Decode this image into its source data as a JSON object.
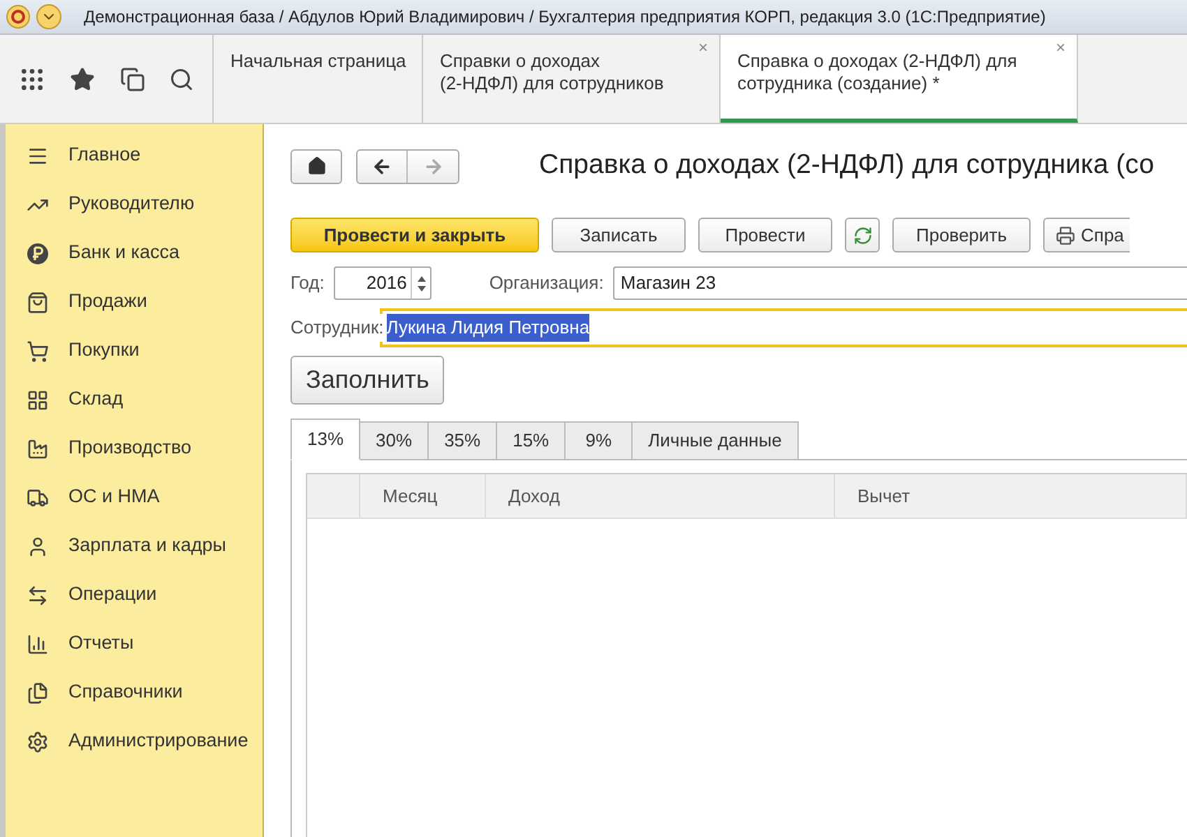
{
  "window": {
    "title": "Демонстрационная база / Абдулов Юрий Владимирович / Бухгалтерия предприятия КОРП, редакция 3.0  (1С:Предприятие)"
  },
  "tabs": [
    {
      "lines": [
        "Начальная страница"
      ],
      "selected": false
    },
    {
      "lines": [
        "Справки о доходах",
        "(2-НДФЛ) для сотрудников"
      ],
      "selected": false,
      "close": "×"
    },
    {
      "lines": [
        "Справка о доходах (2-НДФЛ) для",
        "сотрудника (создание) *"
      ],
      "selected": true,
      "close": "×"
    }
  ],
  "sidebar": {
    "items": [
      {
        "label": "Главное"
      },
      {
        "label": "Руководителю"
      },
      {
        "label": "Банк и касса"
      },
      {
        "label": "Продажи"
      },
      {
        "label": "Покупки"
      },
      {
        "label": "Склад"
      },
      {
        "label": "Производство"
      },
      {
        "label": "ОС и НМА"
      },
      {
        "label": "Зарплата и кадры"
      },
      {
        "label": "Операции"
      },
      {
        "label": "Отчеты"
      },
      {
        "label": "Справочники"
      },
      {
        "label": "Администрирование"
      }
    ]
  },
  "form": {
    "title": "Справка о доходах (2-НДФЛ) для сотрудника (со",
    "toolbar": [
      {
        "kind": "primary",
        "label": "Провести и закрыть"
      },
      {
        "kind": "plain",
        "label": "Записать"
      },
      {
        "kind": "plain",
        "label": "Провести"
      },
      {
        "kind": "icon"
      },
      {
        "kind": "plain",
        "label": "Проверить"
      },
      {
        "kind": "print",
        "label": "Спра"
      }
    ],
    "year": {
      "label": "Год:",
      "value": "2016"
    },
    "organization": {
      "label": "Организация:",
      "value": "Магазин 23"
    },
    "employee": {
      "label": "Сотрудник:",
      "value": "Лукина  Лидия Петровна",
      "highlighted": true
    },
    "fill_button": "Заполнить",
    "tabs": [
      {
        "label": "13%",
        "selected": true
      },
      {
        "label": "30%",
        "selected": false
      },
      {
        "label": "35%",
        "selected": false
      },
      {
        "label": "15%",
        "selected": false
      },
      {
        "label": "9%",
        "selected": false
      },
      {
        "label": "Личные данные",
        "selected": false
      }
    ],
    "table": {
      "columns": [
        "Месяц",
        "Доход",
        "Вычет"
      ]
    }
  }
}
